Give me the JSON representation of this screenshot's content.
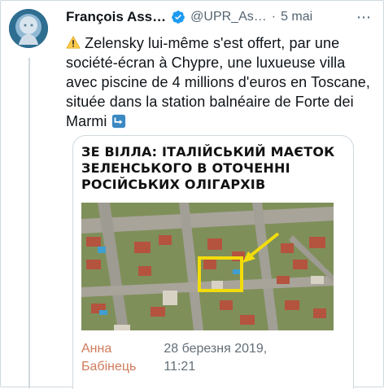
{
  "tweet": {
    "author_name": "François Ass…",
    "author_handle": "@UPR_As…",
    "separator": "·",
    "date": "5 mai",
    "text": "Zelensky lui-même s'est offert, par une société-écran à  Chypre, une luxueuse villa avec piscine de 4 millions d'euros en Toscane, située dans la station balnéaire de Forte dei Marmi",
    "emoji_start": "warning-emoji",
    "emoji_end": "arrow-down-emoji"
  },
  "card": {
    "headline": "ЗЕ ВІЛЛА: ІТАЛІЙСЬКИЙ МАЄТОК ЗЕЛЕНСЬКОГО В ОТОЧЕННІ РОСІЙСЬКИХ ОЛІГАРХІВ",
    "author_line1": "Анна",
    "author_line2": "Бабінець",
    "date_line1": "28 березня 2019,",
    "date_line2": "11:21"
  },
  "colors": {
    "verified": "#1d9bf0",
    "accent_author": "#d07a5a",
    "highlight": "#f2dc0b"
  }
}
